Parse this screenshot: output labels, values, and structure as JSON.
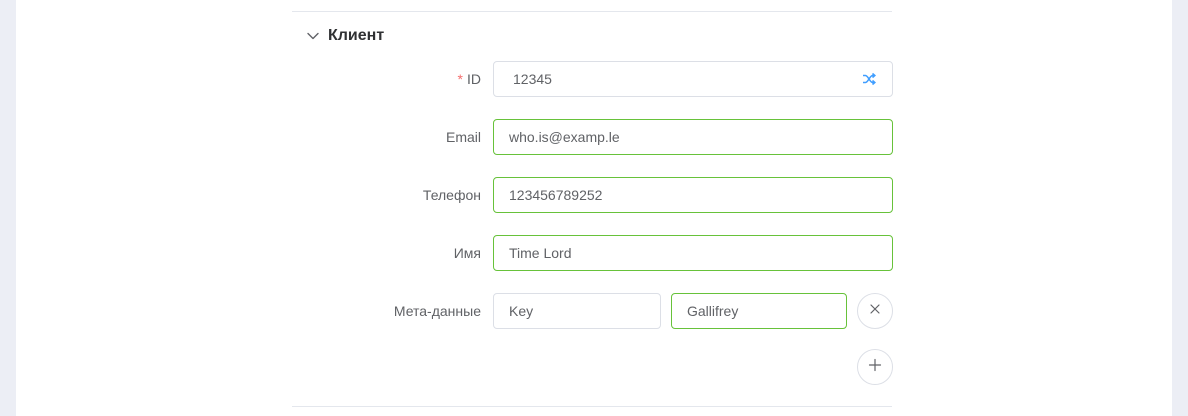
{
  "section": {
    "title": "Клиент",
    "icon": "chevron-down-icon"
  },
  "form": {
    "id": {
      "label": "ID",
      "required_mark": "*",
      "value": "12345",
      "action_icon": "shuffle-icon"
    },
    "email": {
      "label": "Email",
      "value": "who.is@examp.le"
    },
    "phone": {
      "label": "Телефон",
      "value": "123456789252"
    },
    "name": {
      "label": "Имя",
      "value": "Time Lord"
    },
    "metadata": {
      "label": "Мета-данные",
      "key": "Key",
      "value": "Gallifrey",
      "remove_icon": "close-icon",
      "add_icon": "plus-icon"
    }
  },
  "colors": {
    "accent": "#409eff",
    "success_border": "#67c23a",
    "required": "#f56c6c",
    "border": "#dcdfe6",
    "background": "#eceef5"
  }
}
